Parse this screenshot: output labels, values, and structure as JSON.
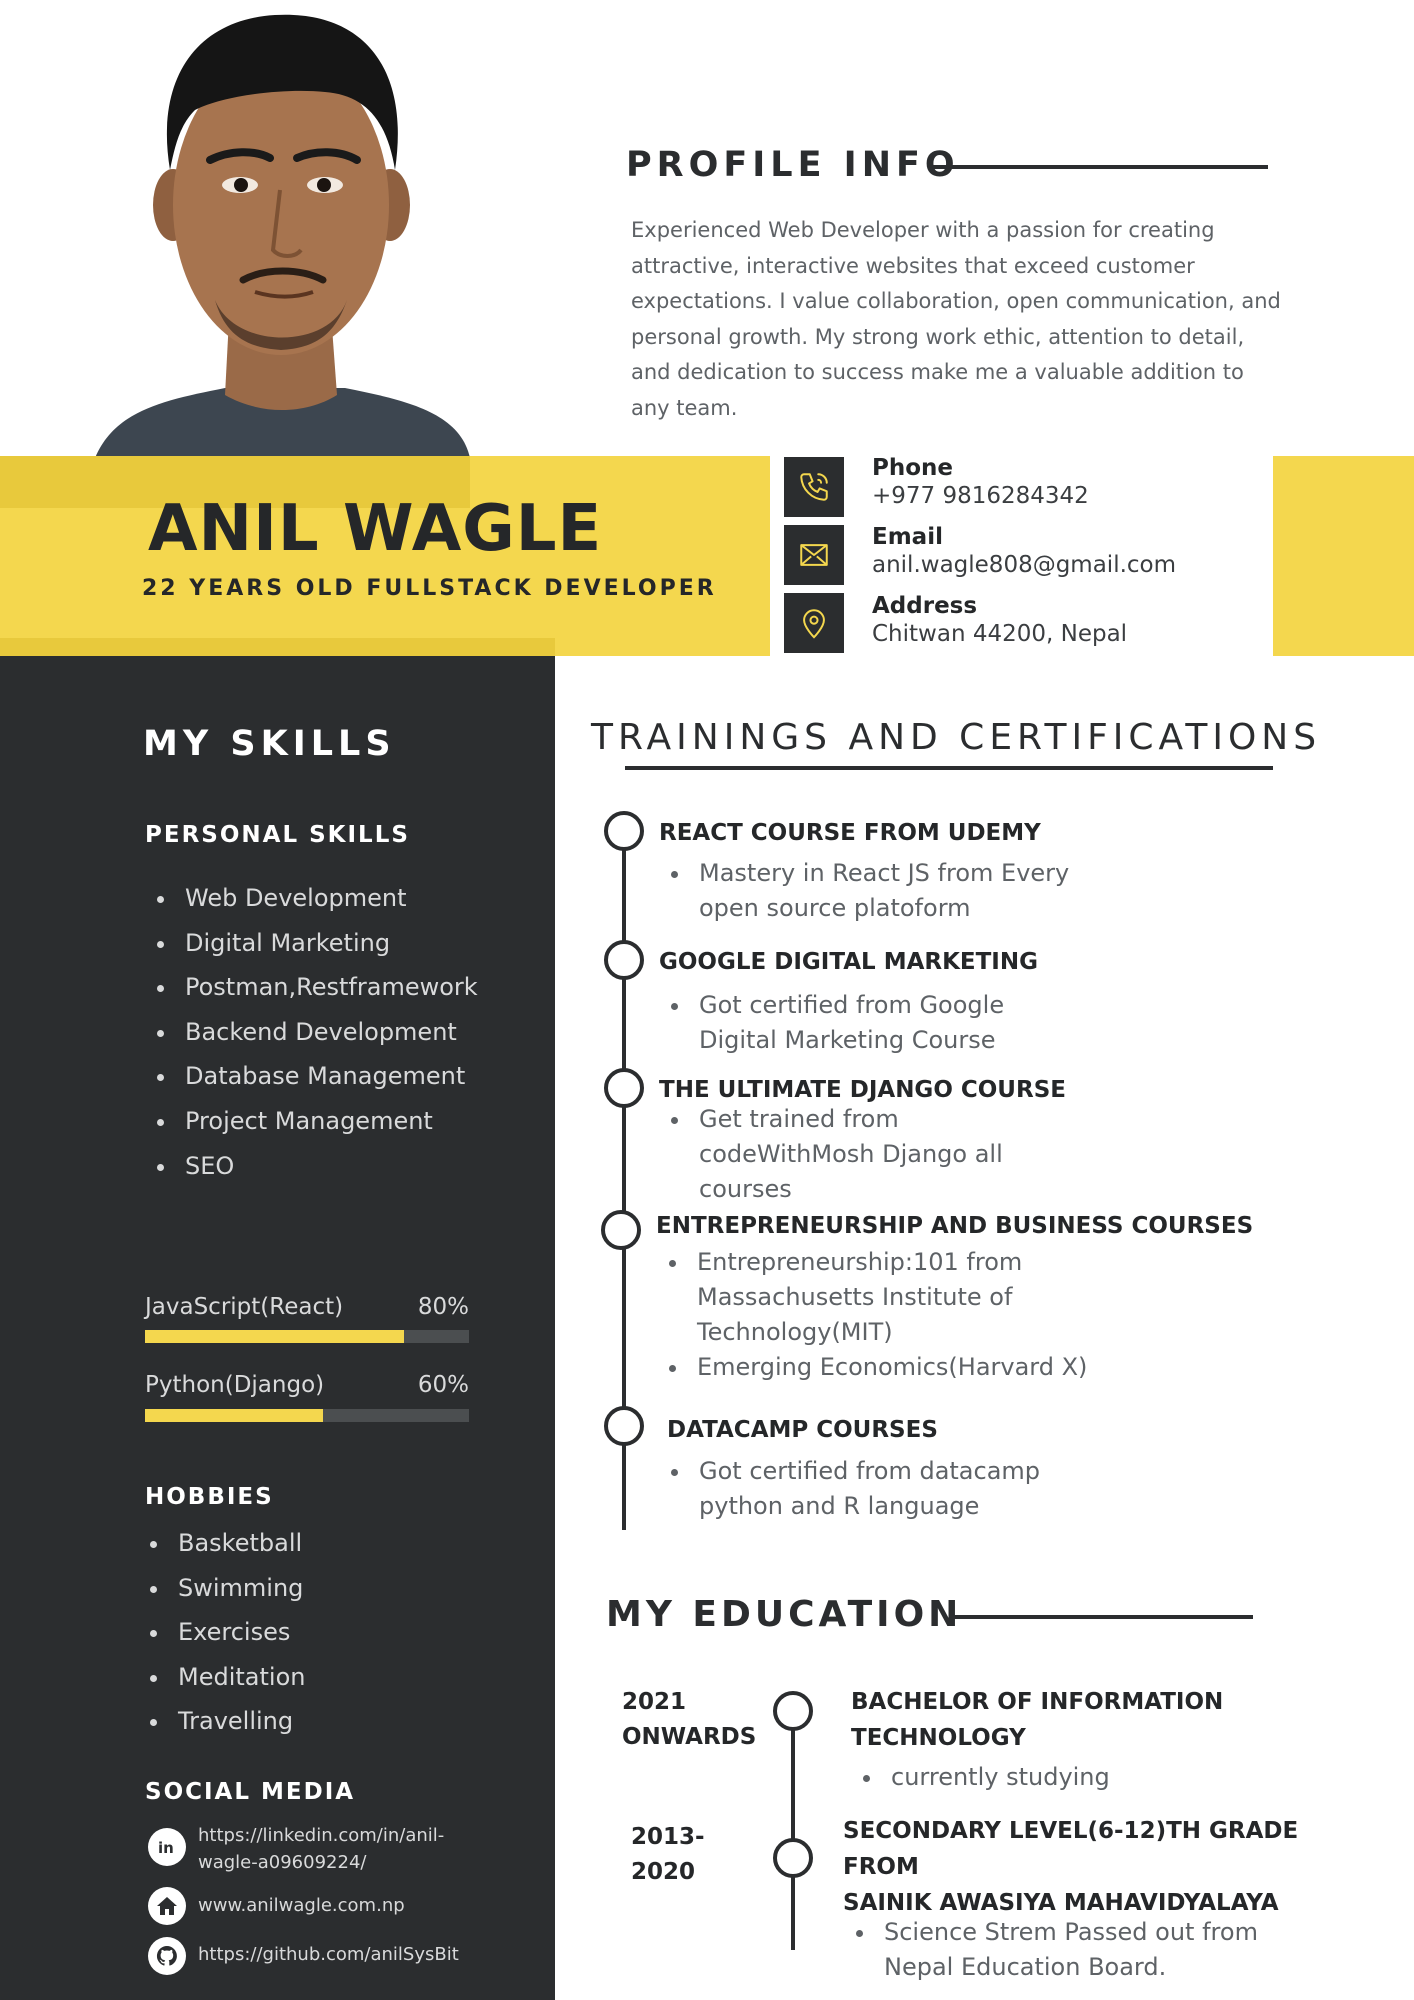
{
  "profile": {
    "title": "PROFILE INFO",
    "text": "Experienced Web Developer with a passion for creating attractive, interactive websites that exceed customer expectations. I value collaboration, open communication, and personal growth. My strong work ethic, attention to detail, and dedication to success make me a valuable addition to any team."
  },
  "header": {
    "name": "ANIL WAGLE",
    "subtitle": "22 YEARS OLD FULLSTACK DEVELOPER"
  },
  "contact": {
    "phone_label": "Phone",
    "phone": "+977 9816284342",
    "email_label": "Email",
    "email": "anil.wagle808@gmail.com",
    "address_label": "Address",
    "address": "Chitwan 44200, Nepal"
  },
  "skills": {
    "title": "MY SKILLS",
    "personal_heading": "PERSONAL SKILLS",
    "personal": [
      "Web Development",
      "Digital Marketing",
      "Postman,Restframework",
      "Backend Development",
      "Database Management",
      "Project Management",
      "SEO"
    ],
    "bars": [
      {
        "label": "JavaScript(React)",
        "pct_text": "80%",
        "value": 0.8
      },
      {
        "label": "Python(Django)",
        "pct_text": "60%",
        "value": 0.55
      }
    ]
  },
  "hobbies": {
    "heading": "HOBBIES",
    "items": [
      "Basketball",
      "Swimming",
      "Exercises",
      "Meditation",
      "Travelling"
    ]
  },
  "social": {
    "heading": "SOCIAL MEDIA",
    "linkedin": "https://linkedin.com/in/anil-wagle-a09609224/",
    "website": "www.anilwagle.com.np",
    "github": "https://github.com/anilSysBit"
  },
  "trainings": {
    "title": "TRAININGS AND CERTIFICATIONS",
    "items": [
      {
        "heading": "REACT COURSE FROM UDEMY",
        "bullets": [
          "Mastery in React JS from Every open source platoform"
        ]
      },
      {
        "heading": "GOOGLE DIGITAL MARKETING",
        "bullets": [
          "Got certified from Google Digital Marketing Course"
        ]
      },
      {
        "heading": "THE ULTIMATE DJANGO COURSE",
        "bullets": [
          "Get trained from codeWithMosh Django all courses"
        ]
      },
      {
        "heading": "ENTREPRENEURSHIP AND BUSINESS COURSES",
        "bullets": [
          "Entrepreneurship:101 from Massachusetts Institute of Technology(MIT)",
          "Emerging Economics(Harvard X)"
        ]
      },
      {
        "heading": "DATACAMP COURSES",
        "bullets": [
          "Got certified from datacamp python and R language"
        ]
      }
    ]
  },
  "education": {
    "title": "MY EDUCATION",
    "items": [
      {
        "year_line1": "2021",
        "year_line2": "ONWARDS",
        "heading_line1": "BACHELOR OF INFORMATION",
        "heading_line2": "TECHNOLOGY",
        "heading_line3": "",
        "bullet": "currently studying"
      },
      {
        "year_line1": "2013-",
        "year_line2": "2020",
        "heading_line1": "SECONDARY LEVEL(6-12)TH GRADE",
        "heading_line2": "FROM",
        "heading_line3": "SAINIK AWASIYA MAHAVIDYALAYA",
        "bullet": "Science Strem Passed out from Nepal Education Board."
      }
    ]
  },
  "icons": {
    "phone": "phone-icon",
    "email": "envelope-icon",
    "address": "location-pin-icon",
    "linkedin": "linkedin-icon",
    "website": "home-icon",
    "github": "github-icon"
  },
  "colors": {
    "accent": "#f4d74e",
    "dark": "#2b2d2f",
    "text_muted": "#5e6266"
  }
}
